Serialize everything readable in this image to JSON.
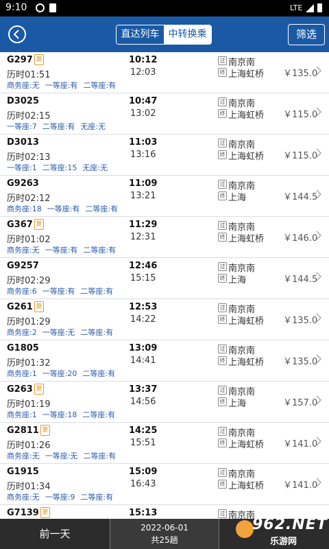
{
  "status_bar": {
    "time": "9:10",
    "network": "LTE"
  },
  "header": {
    "segments": [
      {
        "label": "直达列车",
        "active": false
      },
      {
        "label": "中转换乘",
        "active": true
      }
    ],
    "filter_label": "筛选"
  },
  "fu_label": "复",
  "station_icons": {
    "from": "过",
    "to": "终"
  },
  "trains": [
    {
      "number": "G297",
      "fu": true,
      "dep": "10:12",
      "arr": "12:03",
      "duration": "历时01:51",
      "from": "南京南",
      "to": "上海虹桥",
      "price": "￥135.0",
      "seats": [
        "商务座:无",
        "一等座:有",
        "二等座:有"
      ]
    },
    {
      "number": "D3025",
      "fu": false,
      "dep": "10:47",
      "arr": "13:02",
      "duration": "历时02:15",
      "from": "南京南",
      "to": "上海虹桥",
      "price": "￥115.0",
      "seats": [
        "一等座:7",
        "二等座:有",
        "无座:无"
      ]
    },
    {
      "number": "D3013",
      "fu": false,
      "dep": "11:03",
      "arr": "13:16",
      "duration": "历时02:13",
      "from": "南京南",
      "to": "上海虹桥",
      "price": "￥115.0",
      "seats": [
        "一等座:1",
        "二等座:15",
        "无座:无"
      ]
    },
    {
      "number": "G9263",
      "fu": false,
      "dep": "11:09",
      "arr": "13:21",
      "duration": "历时02:12",
      "from": "南京南",
      "to": "上海",
      "price": "￥144.5",
      "seats": [
        "商务座:18",
        "一等座:有",
        "二等座:有"
      ]
    },
    {
      "number": "G367",
      "fu": true,
      "dep": "11:29",
      "arr": "12:31",
      "duration": "历时01:02",
      "from": "南京南",
      "to": "上海虹桥",
      "price": "￥146.0",
      "seats": [
        "商务座:无",
        "一等座:有",
        "二等座:有"
      ]
    },
    {
      "number": "G9257",
      "fu": false,
      "dep": "12:46",
      "arr": "15:15",
      "duration": "历时02:29",
      "from": "南京南",
      "to": "上海",
      "price": "￥144.5",
      "seats": [
        "商务座:6",
        "一等座:有",
        "二等座:有"
      ]
    },
    {
      "number": "G261",
      "fu": true,
      "dep": "12:53",
      "arr": "14:22",
      "duration": "历时01:29",
      "from": "南京南",
      "to": "上海虹桥",
      "price": "￥135.0",
      "seats": [
        "商务座:2",
        "一等座:无",
        "二等座:有"
      ]
    },
    {
      "number": "G1805",
      "fu": false,
      "dep": "13:09",
      "arr": "14:41",
      "duration": "历时01:32",
      "from": "南京南",
      "to": "上海虹桥",
      "price": "￥135.0",
      "seats": [
        "商务座:1",
        "一等座:20",
        "二等座:有"
      ]
    },
    {
      "number": "G263",
      "fu": true,
      "dep": "13:37",
      "arr": "14:56",
      "duration": "历时01:19",
      "from": "南京南",
      "to": "上海",
      "price": "￥157.0",
      "seats": [
        "商务座:1",
        "一等座:18",
        "二等座:有"
      ]
    },
    {
      "number": "G2811",
      "fu": true,
      "dep": "14:25",
      "arr": "15:51",
      "duration": "历时01:26",
      "from": "南京南",
      "to": "上海虹桥",
      "price": "￥141.0",
      "seats": [
        "商务座:无",
        "一等座:无",
        "二等座:有"
      ]
    },
    {
      "number": "G1915",
      "fu": false,
      "dep": "15:09",
      "arr": "16:43",
      "duration": "历时01:34",
      "from": "南京南",
      "to": "上海虹桥",
      "price": "￥141.0",
      "seats": [
        "商务座:无",
        "一等座:9",
        "二等座:有"
      ]
    },
    {
      "number": "G7139",
      "fu": true,
      "dep": "15:13",
      "arr": "",
      "duration": "",
      "from": "南京南",
      "to": "",
      "price": "",
      "seats": []
    }
  ],
  "bottom_bar": {
    "prev_label": "前一天",
    "date": "2022-06-01",
    "count": "共25趟"
  },
  "watermark": {
    "main": "962.NET",
    "sub": "乐游网"
  }
}
